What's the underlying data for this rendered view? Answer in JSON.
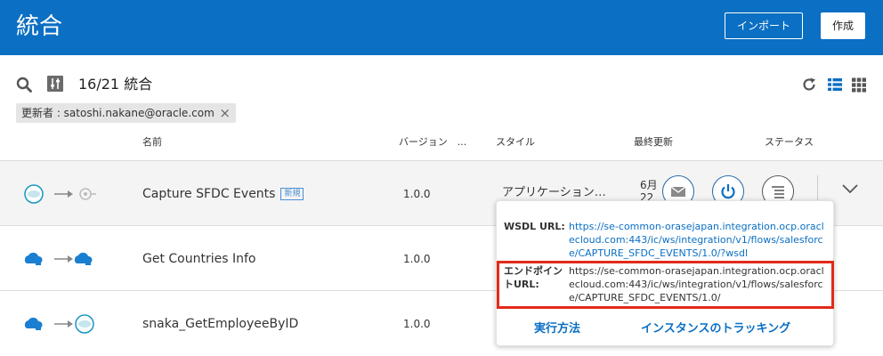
{
  "header": {
    "title": "統合",
    "import_label": "インポート",
    "create_label": "作成",
    "background_color": "#0b6fc3"
  },
  "toolbar": {
    "count_label": "16/21 統合"
  },
  "filter_chip": {
    "text": "更新者 : satoshi.nakane@oracle.com",
    "close": "×"
  },
  "table": {
    "columns": [
      "名前",
      "バージョン　...",
      "スタイル",
      "最終更新",
      "ステータス"
    ],
    "rows": [
      {
        "name": "Capture SFDC Events",
        "badge": "新規",
        "version": "1.0.0",
        "style": "アプリケーション…",
        "date_fragment": "6月\n22",
        "source_icon": "salesforce-icon",
        "target_icon": "rest-trigger-icon"
      },
      {
        "name": "Get Countries Info",
        "version": "1.0.0",
        "source_icon": "cloud-plug-icon",
        "target_icon": "cloud-plug-icon"
      },
      {
        "name": "snaka_GetEmployeeByID",
        "version": "1.0.0",
        "source_icon": "cloud-plug-icon",
        "target_icon": "salesforce-icon"
      }
    ]
  },
  "popover": {
    "wsdl_label": "WSDL URL:",
    "wsdl_url": "https://se-common-orasejapan.integration.ocp.oraclecloud.com:443/ic/ws/integration/v1/flows/salesforce/CAPTURE_SFDC_EVENTS/1.0/?wsdl",
    "endpoint_label": "エンドポイントURL:",
    "endpoint_url": "https://se-common-orasejapan.integration.ocp.oraclecloud.com:443/ic/ws/integration/v1/flows/salesforce/CAPTURE_SFDC_EVENTS/1.0/",
    "run_label": "実行方法",
    "tracking_label": "インスタンスのトラッキング",
    "link_color": "#0b6fc3",
    "highlight_color": "#e22a1a"
  }
}
